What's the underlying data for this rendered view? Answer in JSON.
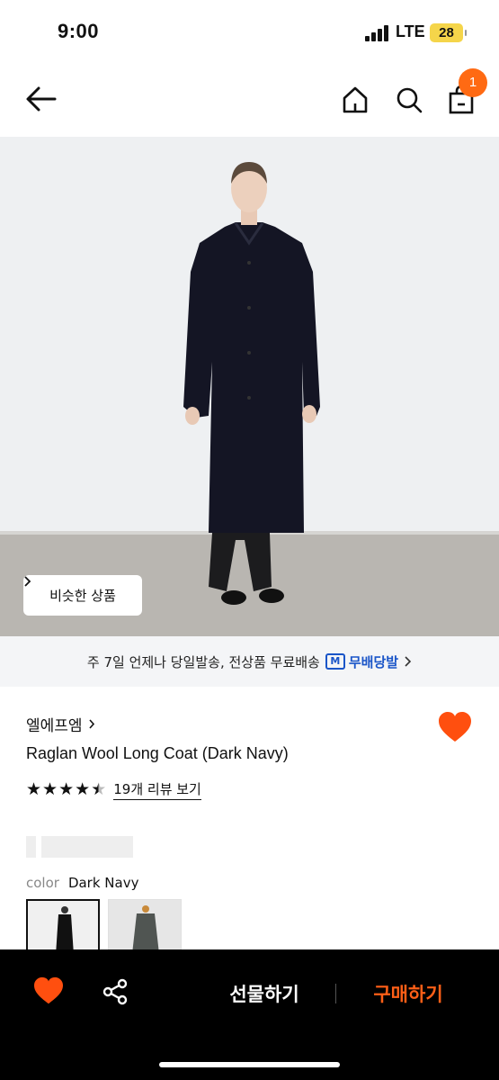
{
  "status_bar": {
    "time": "9:00",
    "network": "LTE",
    "battery": "28"
  },
  "nav": {
    "cart_count": "1"
  },
  "hero": {
    "similar_label": "비슷한 상품"
  },
  "shipping": {
    "text": "주 7일 언제나 당일발송, 전상품 무료배송",
    "brand_badge": "M",
    "brand": "무배당발"
  },
  "product": {
    "brand": "엘에프엠",
    "title": "Raglan Wool Long Coat (Dark Navy)",
    "rating": 4.5,
    "review_link": "19개 리뷰 보기",
    "color_label": "color",
    "color_value": "Dark Navy"
  },
  "bottom": {
    "gift_label": "선물하기",
    "buy_label": "구매하기"
  },
  "colors": {
    "accent": "#ff5f17",
    "badge": "#ff6a13",
    "heart": "#ff4f0f",
    "brand_blue": "#1a55c8"
  }
}
